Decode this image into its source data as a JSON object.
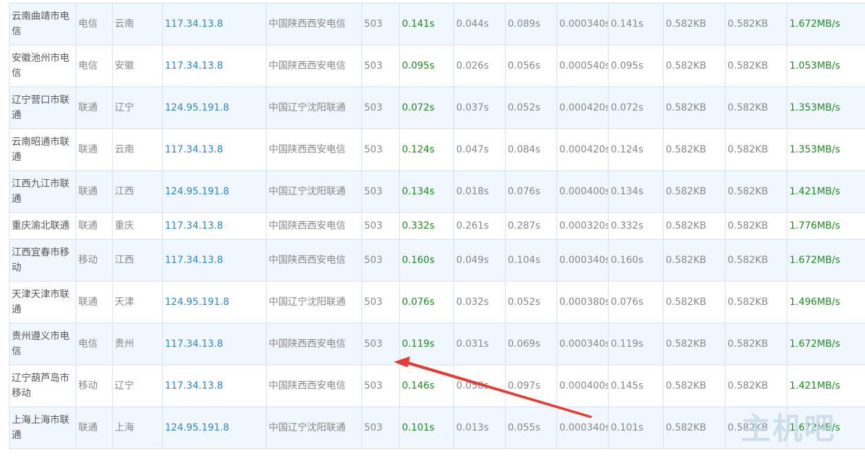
{
  "rows": [
    {
      "location": "云南曲靖市电信",
      "isp": "电信",
      "province": "云南",
      "ip": "117.34.13.8",
      "ip_location": "中国陕西西安电信",
      "code": "503",
      "total": "0.141s",
      "dns": "0.044s",
      "connect": "0.089s",
      "download": "0.000340s",
      "total2": "0.141s",
      "size": "0.582KB",
      "size2": "0.582KB",
      "speed": "1.672MB/s"
    },
    {
      "location": "安徽池州市电信",
      "isp": "电信",
      "province": "安徽",
      "ip": "117.34.13.8",
      "ip_location": "中国陕西西安电信",
      "code": "503",
      "total": "0.095s",
      "dns": "0.026s",
      "connect": "0.056s",
      "download": "0.000540s",
      "total2": "0.095s",
      "size": "0.582KB",
      "size2": "0.582KB",
      "speed": "1.053MB/s"
    },
    {
      "location": "辽宁营口市联通",
      "isp": "联通",
      "province": "辽宁",
      "ip": "124.95.191.8",
      "ip_location": "中国辽宁沈阳联通",
      "code": "503",
      "total": "0.072s",
      "dns": "0.037s",
      "connect": "0.052s",
      "download": "0.000420s",
      "total2": "0.072s",
      "size": "0.582KB",
      "size2": "0.582KB",
      "speed": "1.353MB/s"
    },
    {
      "location": "云南昭通市联通",
      "isp": "联通",
      "province": "云南",
      "ip": "117.34.13.8",
      "ip_location": "中国陕西西安电信",
      "code": "503",
      "total": "0.124s",
      "dns": "0.047s",
      "connect": "0.084s",
      "download": "0.000420s",
      "total2": "0.124s",
      "size": "0.582KB",
      "size2": "0.582KB",
      "speed": "1.353MB/s"
    },
    {
      "location": "江西九江市联通",
      "isp": "联通",
      "province": "江西",
      "ip": "124.95.191.8",
      "ip_location": "中国辽宁沈阳联通",
      "code": "503",
      "total": "0.134s",
      "dns": "0.018s",
      "connect": "0.076s",
      "download": "0.000400s",
      "total2": "0.134s",
      "size": "0.582KB",
      "size2": "0.582KB",
      "speed": "1.421MB/s"
    },
    {
      "location": "重庆渝北联通",
      "isp": "联通",
      "province": "重庆",
      "ip": "117.34.13.8",
      "ip_location": "中国陕西西安电信",
      "code": "503",
      "total": "0.332s",
      "dns": "0.261s",
      "connect": "0.287s",
      "download": "0.000320s",
      "total2": "0.332s",
      "size": "0.582KB",
      "size2": "0.582KB",
      "speed": "1.776MB/s"
    },
    {
      "location": "江西宜春市移动",
      "isp": "移动",
      "province": "江西",
      "ip": "117.34.13.8",
      "ip_location": "中国陕西西安电信",
      "code": "503",
      "total": "0.160s",
      "dns": "0.049s",
      "connect": "0.104s",
      "download": "0.000340s",
      "total2": "0.160s",
      "size": "0.582KB",
      "size2": "0.582KB",
      "speed": "1.672MB/s"
    },
    {
      "location": "天津天津市联通",
      "isp": "联通",
      "province": "天津",
      "ip": "124.95.191.8",
      "ip_location": "中国辽宁沈阳联通",
      "code": "503",
      "total": "0.076s",
      "dns": "0.032s",
      "connect": "0.052s",
      "download": "0.000380s",
      "total2": "0.076s",
      "size": "0.582KB",
      "size2": "0.582KB",
      "speed": "1.496MB/s"
    },
    {
      "location": "贵州遵义市电信",
      "isp": "电信",
      "province": "贵州",
      "ip": "117.34.13.8",
      "ip_location": "中国陕西西安电信",
      "code": "503",
      "total": "0.119s",
      "dns": "0.031s",
      "connect": "0.069s",
      "download": "0.000340s",
      "total2": "0.119s",
      "size": "0.582KB",
      "size2": "0.582KB",
      "speed": "1.672MB/s"
    },
    {
      "location": "辽宁葫芦岛市移动",
      "isp": "移动",
      "province": "辽宁",
      "ip": "117.34.13.8",
      "ip_location": "中国陕西西安电信",
      "code": "503",
      "total": "0.146s",
      "dns": "0.058s",
      "connect": "0.097s",
      "download": "0.000400s",
      "total2": "0.145s",
      "size": "0.582KB",
      "size2": "0.582KB",
      "speed": "1.421MB/s"
    },
    {
      "location": "上海上海市联通",
      "isp": "联通",
      "province": "上海",
      "ip": "124.95.191.8",
      "ip_location": "中国辽宁沈阳联通",
      "code": "503",
      "total": "0.101s",
      "dns": "0.013s",
      "connect": "0.055s",
      "download": "0.000340s",
      "total2": "0.101s",
      "size": "0.582KB",
      "size2": "0.582KB",
      "speed": "1.672MB/s"
    }
  ],
  "watermark": {
    "text": "主机吧"
  },
  "colors": {
    "ip": "#2b86d6",
    "green": "#1a8f1a",
    "gray": "#888888",
    "alt_row": "#f0f7fe",
    "arrow": "#ea3b32"
  }
}
